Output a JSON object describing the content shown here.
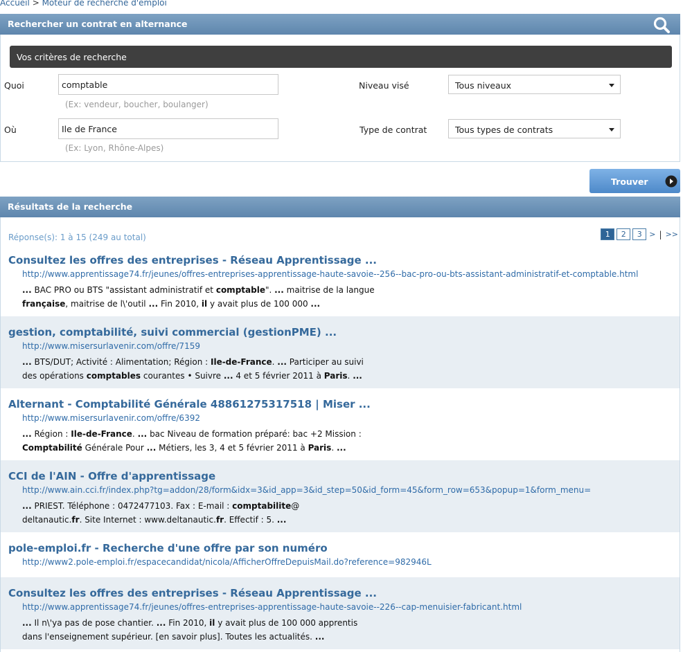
{
  "breadcrumb": {
    "home": "Accueil",
    "separator": ">",
    "current": "Moteur de recherche d'emploi"
  },
  "search_section": {
    "title": "Rechercher un contrat en alternance",
    "icon": "search-icon",
    "criteria_title": "Vos critères de recherche",
    "what": {
      "label": "Quoi",
      "value": "comptable",
      "hint": "(Ex: vendeur, boucher, boulanger)"
    },
    "where": {
      "label": "Où",
      "value": "Ile de France",
      "hint": "(Ex: Lyon, Rhône-Alpes)"
    },
    "level": {
      "label": "Niveau visé",
      "selected": "Tous niveaux"
    },
    "contract_type": {
      "label": "Type de contrat",
      "selected": "Tous types de contrats"
    },
    "find_button": "Trouver"
  },
  "results_section": {
    "title": "Résultats de la recherche",
    "answer_count": "Réponse(s): 1 à 15 (249 au total)",
    "pager": {
      "pages": [
        "1",
        "2",
        "3"
      ],
      "current": "1",
      "next": ">",
      "separator": "|",
      "last": ">>"
    },
    "results": [
      {
        "title": "Consultez les offres des entreprises - Réseau Apprentissage ...",
        "url": "http://www.apprentissage74.fr/jeunes/offres-entreprises-apprentissage-haute-savoie--256--bac-pro-ou-bts-assistant-administratif-et-comptable.html",
        "line1": [
          [
            "b",
            "..."
          ],
          [
            "t",
            " BAC PRO ou BTS \"assistant administratif et "
          ],
          [
            "b",
            "comptable"
          ],
          [
            "t",
            "\". "
          ],
          [
            "b",
            "..."
          ],
          [
            "t",
            " maitrise de la langue"
          ]
        ],
        "line2": [
          [
            "b",
            "française"
          ],
          [
            "t",
            ", maitrise de l\\'outil "
          ],
          [
            "b",
            "..."
          ],
          [
            "t",
            " Fin 2010, "
          ],
          [
            "b",
            "il"
          ],
          [
            "t",
            " y avait plus de 100 000 "
          ],
          [
            "b",
            "..."
          ]
        ]
      },
      {
        "title": "gestion, comptabilité, suivi commercial (gestionPME) ...",
        "url": "http://www.misersurlavenir.com/offre/7159",
        "line1": [
          [
            "b",
            "..."
          ],
          [
            "t",
            " BTS/DUT; Activité : Alimentation; Région : "
          ],
          [
            "b",
            "Ile-de-France"
          ],
          [
            "t",
            ". "
          ],
          [
            "b",
            "..."
          ],
          [
            "t",
            " Participer au suivi"
          ]
        ],
        "line2": [
          [
            "t",
            "des opérations "
          ],
          [
            "b",
            "comptables"
          ],
          [
            "t",
            " courantes • Suivre "
          ],
          [
            "b",
            "..."
          ],
          [
            "t",
            " 4 et 5 février 2011 à "
          ],
          [
            "b",
            "Paris"
          ],
          [
            "t",
            ". "
          ],
          [
            "b",
            "..."
          ]
        ]
      },
      {
        "title": "Alternant - Comptabilité Générale 48861275317518 | Miser ...",
        "url": "http://www.misersurlavenir.com/offre/6392",
        "line1": [
          [
            "b",
            "..."
          ],
          [
            "t",
            " Région : "
          ],
          [
            "b",
            "Ile-de-France"
          ],
          [
            "t",
            ". "
          ],
          [
            "b",
            "..."
          ],
          [
            "t",
            " bac Niveau de formation préparé: bac +2 Mission :"
          ]
        ],
        "line2": [
          [
            "b",
            "Comptabilité"
          ],
          [
            "t",
            " Générale Pour "
          ],
          [
            "b",
            "..."
          ],
          [
            "t",
            " Métiers, les 3, 4 et 5 février 2011 à "
          ],
          [
            "b",
            "Paris"
          ],
          [
            "t",
            ". "
          ],
          [
            "b",
            "..."
          ]
        ]
      },
      {
        "title": "CCI de l'AIN - Offre d'apprentissage",
        "url": "http://www.ain.cci.fr/index.php?tg=addon/28/form&idx=3&id_app=3&id_step=50&id_form=45&form_row=653&popup=1&form_menu=",
        "line1": [
          [
            "b",
            "..."
          ],
          [
            "t",
            " PRIEST. Téléphone : 0472477103. Fax : E-mail : "
          ],
          [
            "b",
            "comptabilite"
          ],
          [
            "t",
            "@"
          ]
        ],
        "line2": [
          [
            "t",
            "deltanautic."
          ],
          [
            "b",
            "fr"
          ],
          [
            "t",
            ". Site Internet : www.deltanautic."
          ],
          [
            "b",
            "fr"
          ],
          [
            "t",
            ". Effectif : 5. "
          ],
          [
            "b",
            "..."
          ]
        ]
      },
      {
        "title": "pole-emploi.fr - Recherche d'une offre par son numéro",
        "url": "http://www2.pole-emploi.fr/espacecandidat/nicola/AfficherOffreDepuisMail.do?reference=982946L",
        "line1": [],
        "line2": []
      },
      {
        "title": "Consultez les offres des entreprises - Réseau Apprentissage ...",
        "url": "http://www.apprentissage74.fr/jeunes/offres-entreprises-apprentissage-haute-savoie--226--cap-menuisier-fabricant.html",
        "line1": [
          [
            "b",
            "..."
          ],
          [
            "t",
            " Il n\\'ya pas de pose chantier. "
          ],
          [
            "b",
            "..."
          ],
          [
            "t",
            " Fin 2010, "
          ],
          [
            "b",
            "il"
          ],
          [
            "t",
            " y avait plus de 100 000 apprentis"
          ]
        ],
        "line2": [
          [
            "t",
            "dans l'enseignement supérieur. [en savoir plus]. Toutes les actualités. "
          ],
          [
            "b",
            "..."
          ]
        ]
      }
    ]
  },
  "colors": {
    "section_bar": "#6e94b8",
    "criteria_bar": "#3f3f3f",
    "link": "#35699b",
    "alt_row": "#e8eef3",
    "find_button": "#5d96d2"
  }
}
